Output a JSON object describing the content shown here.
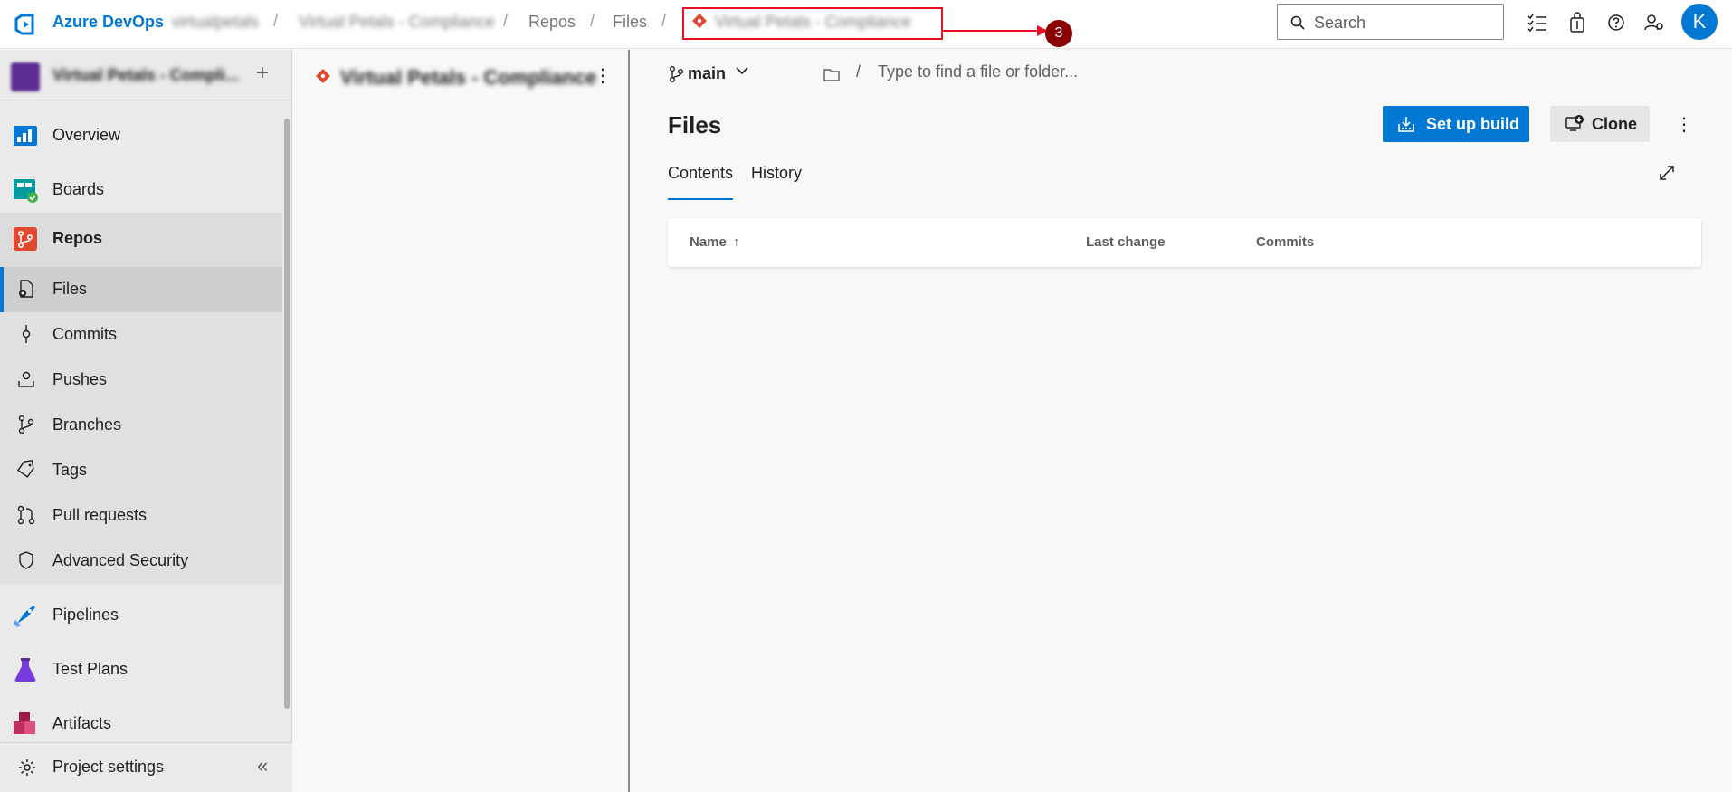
{
  "header": {
    "brand": "Azure DevOps",
    "org": "virtualpetals",
    "project": "Virtual Petals - Compliance",
    "breadcrumb_repos": "Repos",
    "breadcrumb_files": "Files",
    "repo_picker": "Virtual Petals - Compliance",
    "separator": "/",
    "annotation_number": "3",
    "search_placeholder": "Search",
    "avatar_initial": "K"
  },
  "sidebar": {
    "project_name": "Virtual Petals - Compli...",
    "add_label": "+",
    "items": [
      {
        "label": "Overview"
      },
      {
        "label": "Boards"
      },
      {
        "label": "Repos"
      },
      {
        "label": "Pipelines"
      },
      {
        "label": "Test Plans"
      },
      {
        "label": "Artifacts"
      }
    ],
    "repos_sub": [
      {
        "label": "Files"
      },
      {
        "label": "Commits"
      },
      {
        "label": "Pushes"
      },
      {
        "label": "Branches"
      },
      {
        "label": "Tags"
      },
      {
        "label": "Pull requests"
      },
      {
        "label": "Advanced Security"
      }
    ],
    "project_settings": "Project settings",
    "collapse": "«"
  },
  "repo_pane": {
    "title": "Virtual Petals - Compliance",
    "more": "⋮"
  },
  "main": {
    "branch": "main",
    "path_sep": "/",
    "path_placeholder": "Type to find a file or folder...",
    "title": "Files",
    "setup_build": "Set up build",
    "clone": "Clone",
    "more": "⋮",
    "tabs": [
      {
        "label": "Contents"
      },
      {
        "label": "History"
      }
    ],
    "columns": {
      "name": "Name",
      "sort": "↑",
      "last_change": "Last change",
      "commits": "Commits"
    }
  },
  "colors": {
    "accent": "#0078d4",
    "annotation": "#e81123",
    "badge": "#8b0000"
  }
}
